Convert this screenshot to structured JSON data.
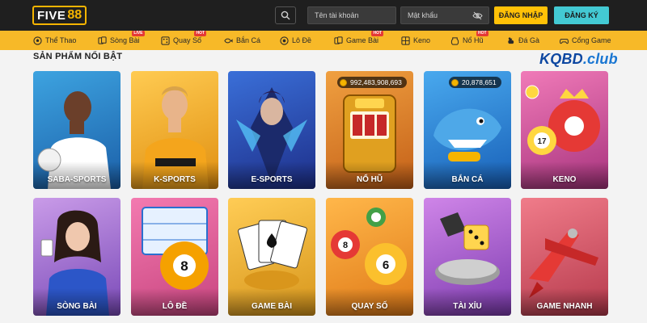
{
  "header": {
    "logo_text": "FIVE",
    "logo_number": "88",
    "username_placeholder": "Tên tài khoản",
    "password_placeholder": "Mật khẩu",
    "login_label": "ĐĂNG NHẬP",
    "register_label": "ĐĂNG KÝ"
  },
  "nav": {
    "items": [
      {
        "label": "Thể Thao",
        "icon": "soccer-ball-icon",
        "badge": ""
      },
      {
        "label": "Sòng Bài",
        "icon": "cards-icon",
        "badge": "LIVE"
      },
      {
        "label": "Quay Số",
        "icon": "lottery-icon",
        "badge": "HOT"
      },
      {
        "label": "Bắn Cá",
        "icon": "fish-icon",
        "badge": ""
      },
      {
        "label": "Lô Đề",
        "icon": "ball-icon",
        "badge": ""
      },
      {
        "label": "Game Bài",
        "icon": "cards-icon",
        "badge": "HOT"
      },
      {
        "label": "Keno",
        "icon": "keno-icon",
        "badge": ""
      },
      {
        "label": "Nổ Hũ",
        "icon": "jar-icon",
        "badge": "HOT"
      },
      {
        "label": "Đá Gà",
        "icon": "rooster-icon",
        "badge": ""
      },
      {
        "label": "Cổng Game",
        "icon": "gamepad-icon",
        "badge": ""
      }
    ]
  },
  "section": {
    "title": "SẢN PHẨM NỔI BẬT",
    "watermark_main": "KQBD",
    "watermark_suffix": ".club"
  },
  "products": [
    {
      "label": "SABA-SPORTS",
      "jackpot": ""
    },
    {
      "label": "K-SPORTS",
      "jackpot": ""
    },
    {
      "label": "E-SPORTS",
      "jackpot": ""
    },
    {
      "label": "NỔ HŨ",
      "jackpot": "992,483,908,693"
    },
    {
      "label": "BẮN CÁ",
      "jackpot": "20,878,651"
    },
    {
      "label": "KENO",
      "jackpot": ""
    },
    {
      "label": "SÒNG BÀI",
      "jackpot": ""
    },
    {
      "label": "LÔ ĐỀ",
      "jackpot": ""
    },
    {
      "label": "GAME BÀI",
      "jackpot": ""
    },
    {
      "label": "QUAY SỐ",
      "jackpot": ""
    },
    {
      "label": "TÀI XỈU",
      "jackpot": ""
    },
    {
      "label": "GAME NHANH",
      "jackpot": ""
    }
  ],
  "colors": {
    "header_bg": "#1f1f1f",
    "nav_bg": "#f7b928",
    "login_button": "#ffc107",
    "register_button": "#43c9d3",
    "watermark": "#1976d2"
  }
}
